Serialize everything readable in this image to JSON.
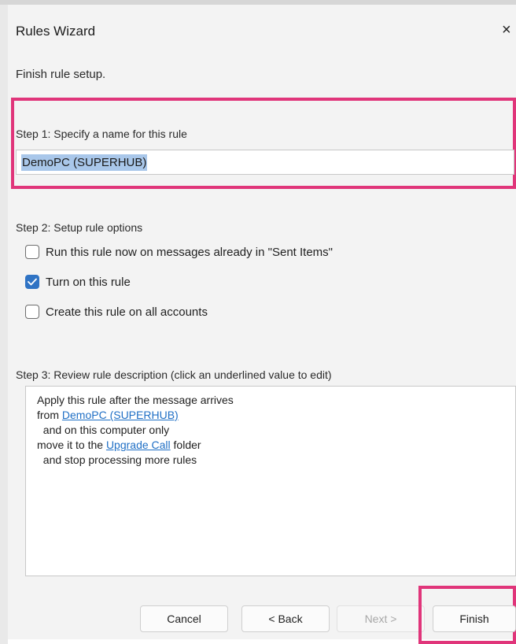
{
  "window": {
    "title": "Rules Wizard",
    "close_glyph": "×"
  },
  "subtitle": "Finish rule setup.",
  "step1": {
    "label": "Step 1: Specify a name for this rule",
    "name_value": "DemoPC (SUPERHUB)"
  },
  "step2": {
    "label": "Step 2: Setup rule options",
    "options": [
      {
        "label": "Run this rule now on messages already in \"Sent Items\"",
        "checked": false
      },
      {
        "label": "Turn on this rule",
        "checked": true
      },
      {
        "label": "Create this rule on all accounts",
        "checked": false
      }
    ]
  },
  "step3": {
    "label": "Step 3: Review rule description (click an underlined value to edit)",
    "lines": {
      "l1": "Apply this rule after the message arrives",
      "l2_prefix": "from ",
      "l2_link": "DemoPC (SUPERHUB)",
      "l3": "  and on this computer only",
      "l4_prefix": "move it to the ",
      "l4_link": "Upgrade Call",
      "l4_suffix": " folder",
      "l5": "  and stop processing more rules"
    }
  },
  "buttons": {
    "cancel": "Cancel",
    "back": "< Back",
    "next": "Next >",
    "finish": "Finish"
  },
  "colors": {
    "highlight": "#e0357a",
    "checkbox_checked": "#2f73c4",
    "link": "#1f6fc5",
    "selection": "#a9c7ea"
  }
}
